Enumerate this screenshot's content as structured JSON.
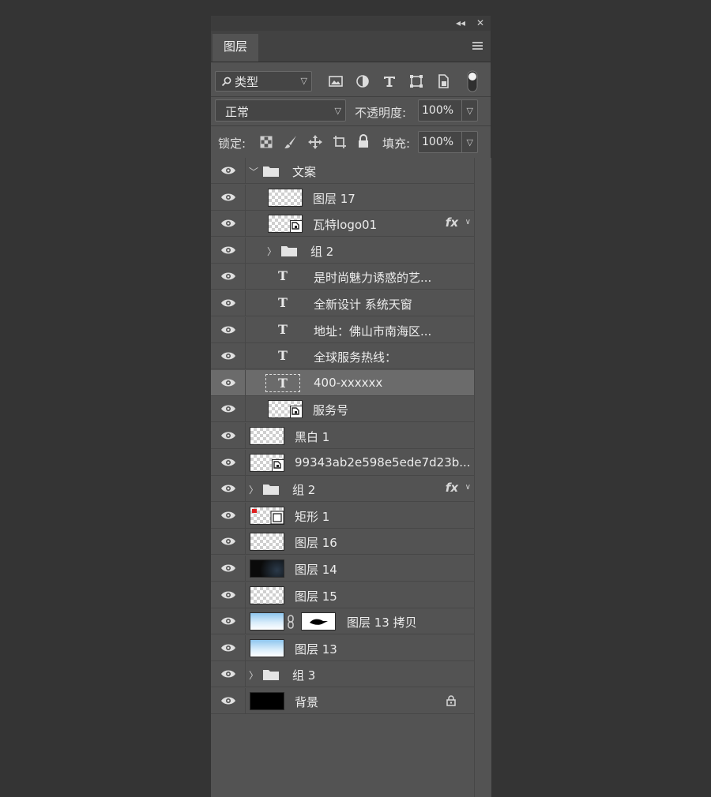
{
  "panel": {
    "tab_label": "图层",
    "collapse_icon": "double-chevron-left-icon",
    "close_icon": "close-icon"
  },
  "filter": {
    "kind_label": "类型",
    "icons": [
      "image-filter-icon",
      "adjustment-filter-icon",
      "type-filter-icon",
      "shape-filter-icon",
      "smart-object-filter-icon",
      "filter-toggle-icon"
    ]
  },
  "blend": {
    "mode": "正常",
    "opacity_label": "不透明度:",
    "opacity_value": "100%"
  },
  "lock": {
    "label": "锁定:",
    "fill_label": "填充:",
    "fill_value": "100%"
  },
  "layers": [
    {
      "name": "文案",
      "type": "group",
      "depth": 0,
      "expanded": true
    },
    {
      "name": "图层 17",
      "type": "pixel",
      "depth": 1
    },
    {
      "name": "瓦特logo01",
      "type": "smart",
      "depth": 1,
      "fx": "fx"
    },
    {
      "name": "组 2",
      "type": "group",
      "depth": 1,
      "expanded": false
    },
    {
      "name": "是时尚魅力诱惑的艺...",
      "type": "text",
      "depth": 1
    },
    {
      "name": "全新设计  系统天窗",
      "type": "text",
      "depth": 1
    },
    {
      "name": "地址：佛山市南海区...",
      "type": "text",
      "depth": 1
    },
    {
      "name": "全球服务热线：",
      "type": "text",
      "depth": 1
    },
    {
      "name": "400-xxxxxx",
      "type": "text",
      "depth": 1,
      "selected": true
    },
    {
      "name": "服务号",
      "type": "smart",
      "depth": 1
    },
    {
      "name": "黑白 1",
      "type": "pixel",
      "depth": 0
    },
    {
      "name": "99343ab2e598e5ede7d23b...",
      "type": "smart",
      "depth": 0
    },
    {
      "name": "组 2",
      "type": "group",
      "depth": 0,
      "expanded": false,
      "fx": "fx"
    },
    {
      "name": "矩形 1",
      "type": "shape",
      "depth": 0
    },
    {
      "name": "图层 16",
      "type": "pixel",
      "depth": 0
    },
    {
      "name": "图层 14",
      "type": "dark",
      "depth": 0
    },
    {
      "name": "图层 15",
      "type": "pixel",
      "depth": 0
    },
    {
      "name": "图层 13 拷贝",
      "type": "masked",
      "depth": 0
    },
    {
      "name": "图层 13",
      "type": "sky",
      "depth": 0
    },
    {
      "name": "组 3",
      "type": "group",
      "depth": 0,
      "expanded": false
    },
    {
      "name": "背景",
      "type": "background",
      "depth": 0,
      "locked": true
    }
  ]
}
